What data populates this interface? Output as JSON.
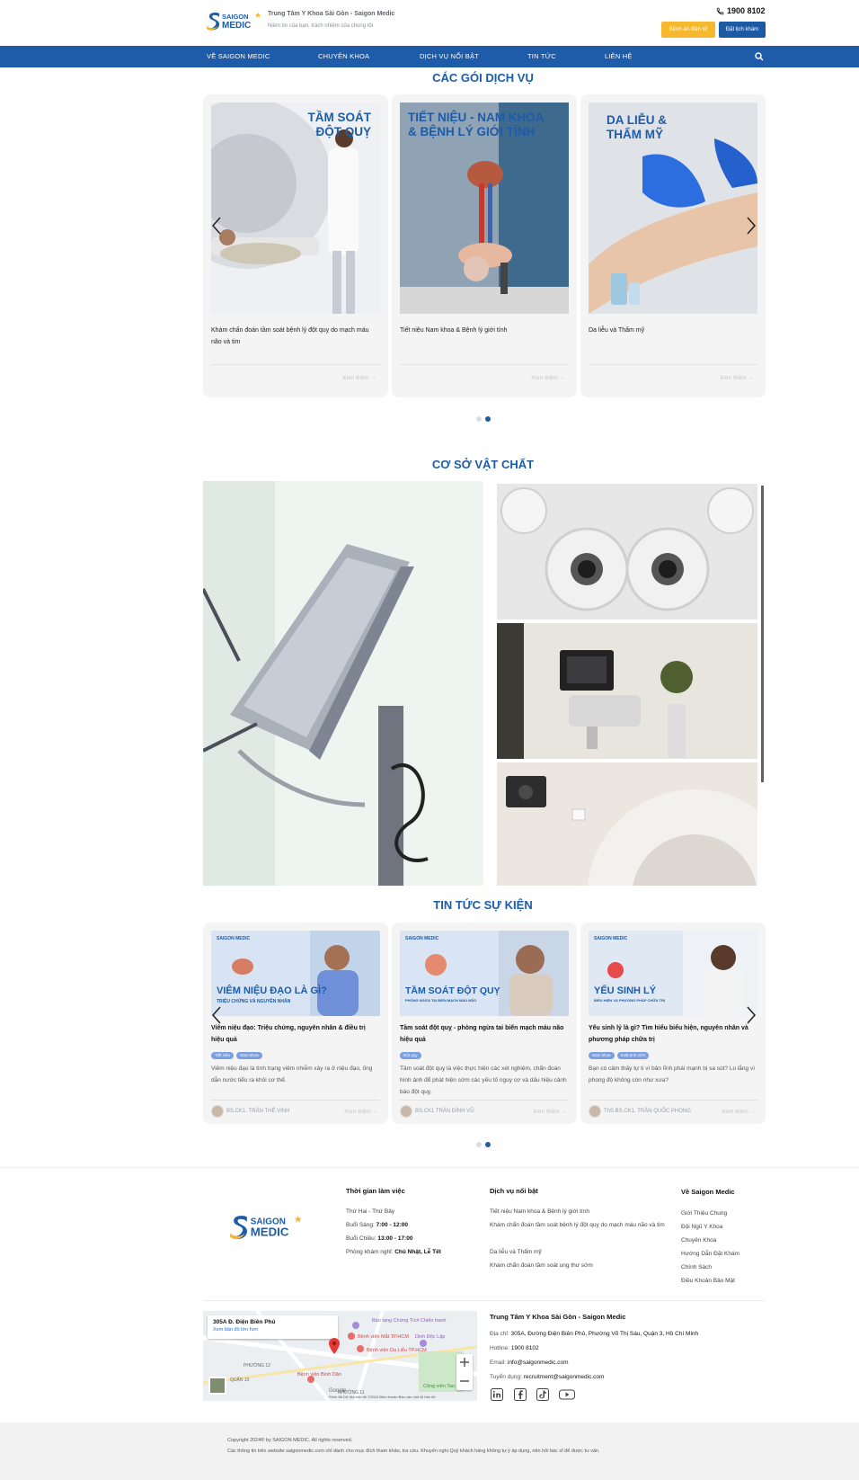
{
  "header": {
    "logo_text_1": "SAIGON",
    "logo_text_2": "MEDIC",
    "site_title": "Trung Tâm Y Khoa Sài Gòn - Saigon Medic",
    "site_slogan": "Niềm tin của bạn, trách nhiệm của chúng tôi",
    "hotline": "1900 8102",
    "btn_online": "Bệnh án điện tử",
    "btn_book": "Đặt lịch khám"
  },
  "nav": {
    "items": [
      "VỀ SAIGON MEDIC",
      "CHUYÊN KHOA",
      "DỊCH VỤ NỔI BẬT",
      "TIN TỨC",
      "LIÊN HỆ"
    ]
  },
  "services": {
    "title": "CÁC GÓI DỊCH VỤ",
    "cards": [
      {
        "img_title_1": "TẦM SOÁT",
        "img_title_2": "ĐỘT QUỴ",
        "desc": "Khám chẩn đoán tầm soát bệnh lý đột quỵ do mạch máu não và tim",
        "more": "Xem thêm"
      },
      {
        "img_title_1": "TIẾT NIỆU - NAM KHOA",
        "img_title_2": "& BỆNH LÝ GIỚI TÍNH",
        "desc": "Tiết niệu Nam khoa & Bệnh lý giới tính",
        "more": "Xem thêm"
      },
      {
        "img_title_1": "DA LIỄU &",
        "img_title_2": "THẨM MỸ",
        "desc": "Da liễu và Thẩm mỹ",
        "more": "Xem thêm"
      }
    ]
  },
  "facilities": {
    "title": "CƠ SỞ VẬT CHẤT"
  },
  "news": {
    "title": "TIN TỨC SỰ KIỆN",
    "cards": [
      {
        "brand": "SAIGON MEDIC",
        "img_title": "VIÊM NIỆU ĐẠO LÀ GÌ?",
        "img_sub": "TRIỆU CHỨNG VÀ NGUYÊN NHÂN",
        "title": "Viêm niệu đạo: Triệu chứng, nguyên nhân & điều trị hiệu quả",
        "tags": [
          "Tiết niệu",
          "Nam khoa"
        ],
        "excerpt": "Viêm niệu đạo là tình trạng viêm nhiễm xảy ra ở niệu đạo, ống dẫn nước tiểu ra khỏi cơ thể.",
        "author": "BS.CK1. TRẦN THẾ VINH",
        "more": "Xem thêm"
      },
      {
        "brand": "SAIGON MEDIC",
        "img_title": "TẦM SOÁT ĐỘT QUỴ",
        "img_sub": "PHÒNG NGỪA TAI BIẾN MẠCH MÁU NÃO",
        "title": "Tầm soát đột quỵ - phòng ngừa tai biến mạch máu não hiệu quả",
        "tags": [
          "Đột quỵ"
        ],
        "excerpt": "Tầm soát đột quỵ là việc thực hiện các xét nghiệm, chẩn đoán hình ảnh để phát hiện sớm các yếu tố nguy cơ và dấu hiệu cảnh báo đột quỵ.",
        "author": "BS.CK1 TRẦN ĐÌNH VŨ",
        "more": "Xem thêm"
      },
      {
        "brand": "SAIGON MEDIC",
        "img_title": "YẾU SINH LÝ",
        "img_sub": "BIỂU HIỆN VÀ PHƯƠNG PHÁP CHỮA TRỊ",
        "title": "Yếu sinh lý là gì? Tìm hiểu biểu hiện, nguyên nhân và phương pháp chữa trị",
        "tags": [
          "Nam khoa",
          "Xuất tinh sớm"
        ],
        "excerpt": "Bạn có cảm thấy tự ti vì bản lĩnh phái mạnh bị sa sút? Lo lắng vì phong độ không còn như xưa?",
        "author": "ThS.BS.CK1. TRẦN QUỐC PHONG",
        "more": "Xem thêm"
      }
    ]
  },
  "footer": {
    "hours": {
      "title": "Thời gian làm việc",
      "days": "Thứ Hai - Thứ Bảy",
      "morning_label": "Buổi Sáng:",
      "morning_value": "7:00 - 12:00",
      "afternoon_label": "Buổi Chiều:",
      "afternoon_value": "13:00 - 17:00",
      "closed_label": "Phòng khám nghỉ:",
      "closed_value": "Chủ Nhật, Lễ Tết"
    },
    "services": {
      "title": "Dịch vụ nổi bật",
      "items": [
        "Tiết niệu Nam khoa & Bệnh lý giới tính",
        "Khám chẩn đoán tầm soát bệnh lý đột quỵ do mạch máu não và tim",
        "Da liễu và Thẩm mỹ",
        "Khám chẩn đoán tầm soát ung thư sớm"
      ]
    },
    "about": {
      "title": "Về Saigon Medic",
      "items": [
        "Giới Thiệu Chung",
        "Đội Ngũ Y Khoa",
        "Chuyên Khoa",
        "Hướng Dẫn Đặt Khám",
        "Chính Sách",
        "Điều Khoản Bảo Mật"
      ]
    },
    "map": {
      "place": "305A Đ. Điện Biên Phủ",
      "link": "Xem bản đồ lớn hơn",
      "labels": [
        "Bảo tàng Chứng Tích Chiến tranh",
        "Bệnh viện Mắt TP.HCM",
        "Dinh Độc Lập",
        "Bệnh viện Da Liễu TP.HCM",
        "Bệnh viện Bình Dân",
        "Công viên Tao Đàn",
        "PHƯỜNG 12",
        "PHƯỜNG 11",
        "QUẬN 10"
      ],
      "footer_text": "Phím tắt   Dữ liệu bản đồ ©2024   Điều khoản   Báo cáo một lỗi bản đồ",
      "google": "Google"
    },
    "contact": {
      "name": "Trung Tâm Y Khoa Sài Gòn - Saigon Medic",
      "address_label": "Địa chỉ:",
      "address": "305A, Đường Điện Biên Phủ, Phường Võ Thị Sáu, Quận 3, Hồ Chí Minh",
      "hotline_label": "Hotline:",
      "hotline": "1900 8102",
      "email_label": "Email:",
      "email": "info@saigonmedic.com",
      "recruit_label": "Tuyển dụng:",
      "recruit": "recruitment@saigonmedic.com"
    },
    "copyright": "Copyright 2024® by SAIGON MEDIC. All rights reserved.",
    "disclaimer": "Các thông tin trên website saigonmedic.com chỉ dành cho mục đích tham khảo, tra cứu. Khuyến nghị Quý khách hàng không tự ý áp dụng, nên hỏi bác sĩ để được tư vấn."
  },
  "colors": {
    "brand": "#1e5ba8",
    "accent": "#f5b82e"
  },
  "icons": [
    "phone-icon",
    "search-icon",
    "chevron-left-icon",
    "chevron-right-icon",
    "linkedin-icon",
    "facebook-icon",
    "tiktok-icon",
    "youtube-icon",
    "map-pin-icon",
    "zoom-in-icon",
    "zoom-out-icon"
  ]
}
